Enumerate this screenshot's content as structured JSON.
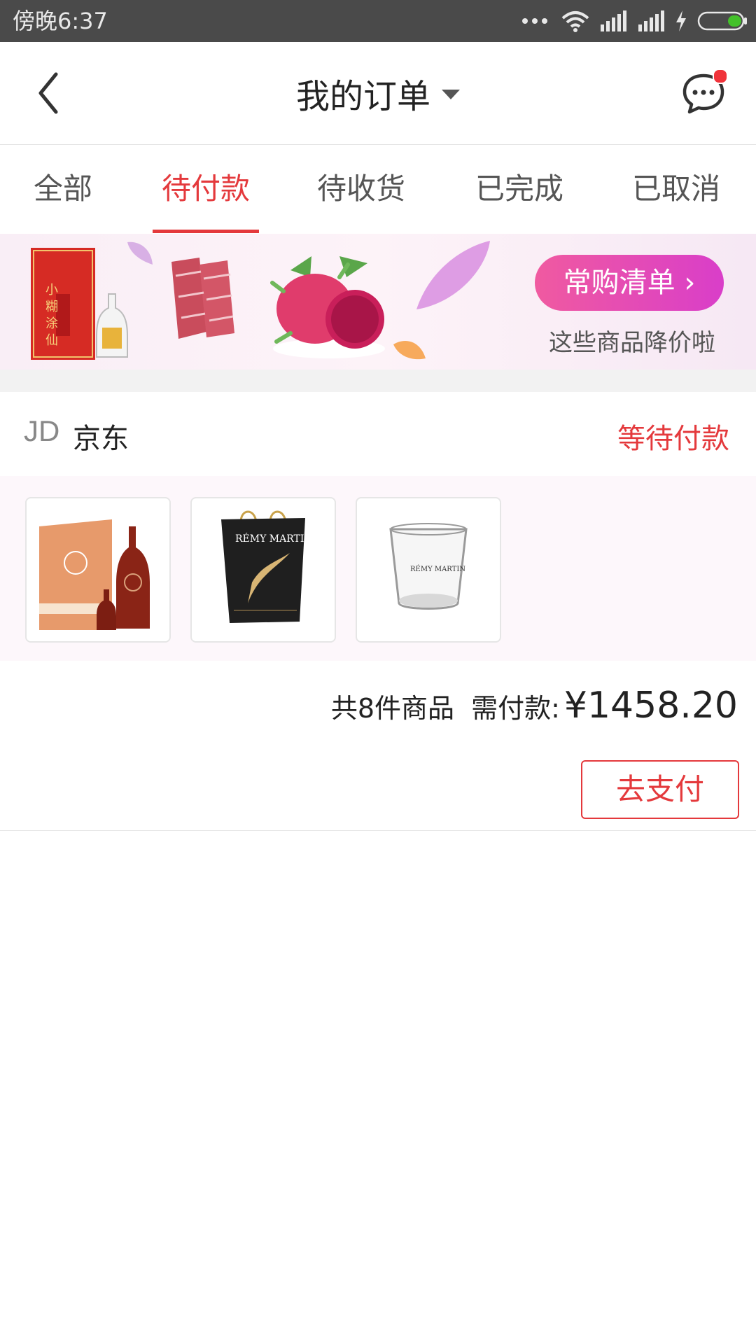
{
  "status_bar": {
    "time": "傍晚6:37"
  },
  "header": {
    "title": "我的订单"
  },
  "tabs": [
    {
      "label": "全部"
    },
    {
      "label": "待付款"
    },
    {
      "label": "待收货"
    },
    {
      "label": "已完成"
    },
    {
      "label": "已取消"
    }
  ],
  "active_tab": "待付款",
  "banner": {
    "cta": "常购清单 ›",
    "subtitle": "这些商品降价啦"
  },
  "order": {
    "store_logo": "JD",
    "store_name": "京东",
    "status": "等待付款",
    "count_text": "共8件商品",
    "need_pay_label": "需付款:",
    "amount": "¥1458.20",
    "pay_button": "去支付"
  },
  "colors": {
    "accent": "#e4393c",
    "banner_cta": "#e04bb8",
    "status_bar": "#4a4a4a"
  }
}
